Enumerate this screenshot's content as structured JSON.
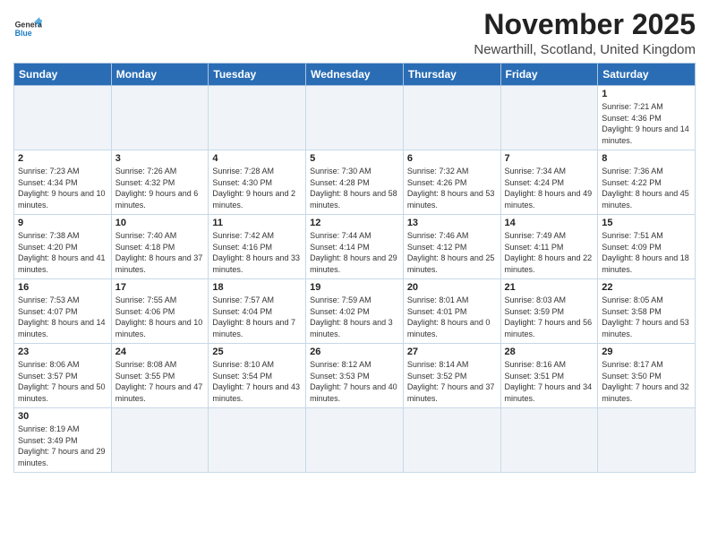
{
  "header": {
    "logo_general": "General",
    "logo_blue": "Blue",
    "title": "November 2025",
    "subtitle": "Newarthill, Scotland, United Kingdom"
  },
  "weekdays": [
    "Sunday",
    "Monday",
    "Tuesday",
    "Wednesday",
    "Thursday",
    "Friday",
    "Saturday"
  ],
  "weeks": [
    [
      {
        "day": "",
        "empty": true
      },
      {
        "day": "",
        "empty": true
      },
      {
        "day": "",
        "empty": true
      },
      {
        "day": "",
        "empty": true
      },
      {
        "day": "",
        "empty": true
      },
      {
        "day": "",
        "empty": true
      },
      {
        "day": "1",
        "sunrise": "7:21 AM",
        "sunset": "4:36 PM",
        "daylight": "9 hours and 14 minutes."
      }
    ],
    [
      {
        "day": "2",
        "sunrise": "7:23 AM",
        "sunset": "4:34 PM",
        "daylight": "9 hours and 10 minutes."
      },
      {
        "day": "3",
        "sunrise": "7:26 AM",
        "sunset": "4:32 PM",
        "daylight": "9 hours and 6 minutes."
      },
      {
        "day": "4",
        "sunrise": "7:28 AM",
        "sunset": "4:30 PM",
        "daylight": "9 hours and 2 minutes."
      },
      {
        "day": "5",
        "sunrise": "7:30 AM",
        "sunset": "4:28 PM",
        "daylight": "8 hours and 58 minutes."
      },
      {
        "day": "6",
        "sunrise": "7:32 AM",
        "sunset": "4:26 PM",
        "daylight": "8 hours and 53 minutes."
      },
      {
        "day": "7",
        "sunrise": "7:34 AM",
        "sunset": "4:24 PM",
        "daylight": "8 hours and 49 minutes."
      },
      {
        "day": "8",
        "sunrise": "7:36 AM",
        "sunset": "4:22 PM",
        "daylight": "8 hours and 45 minutes."
      }
    ],
    [
      {
        "day": "9",
        "sunrise": "7:38 AM",
        "sunset": "4:20 PM",
        "daylight": "8 hours and 41 minutes."
      },
      {
        "day": "10",
        "sunrise": "7:40 AM",
        "sunset": "4:18 PM",
        "daylight": "8 hours and 37 minutes."
      },
      {
        "day": "11",
        "sunrise": "7:42 AM",
        "sunset": "4:16 PM",
        "daylight": "8 hours and 33 minutes."
      },
      {
        "day": "12",
        "sunrise": "7:44 AM",
        "sunset": "4:14 PM",
        "daylight": "8 hours and 29 minutes."
      },
      {
        "day": "13",
        "sunrise": "7:46 AM",
        "sunset": "4:12 PM",
        "daylight": "8 hours and 25 minutes."
      },
      {
        "day": "14",
        "sunrise": "7:49 AM",
        "sunset": "4:11 PM",
        "daylight": "8 hours and 22 minutes."
      },
      {
        "day": "15",
        "sunrise": "7:51 AM",
        "sunset": "4:09 PM",
        "daylight": "8 hours and 18 minutes."
      }
    ],
    [
      {
        "day": "16",
        "sunrise": "7:53 AM",
        "sunset": "4:07 PM",
        "daylight": "8 hours and 14 minutes."
      },
      {
        "day": "17",
        "sunrise": "7:55 AM",
        "sunset": "4:06 PM",
        "daylight": "8 hours and 10 minutes."
      },
      {
        "day": "18",
        "sunrise": "7:57 AM",
        "sunset": "4:04 PM",
        "daylight": "8 hours and 7 minutes."
      },
      {
        "day": "19",
        "sunrise": "7:59 AM",
        "sunset": "4:02 PM",
        "daylight": "8 hours and 3 minutes."
      },
      {
        "day": "20",
        "sunrise": "8:01 AM",
        "sunset": "4:01 PM",
        "daylight": "8 hours and 0 minutes."
      },
      {
        "day": "21",
        "sunrise": "8:03 AM",
        "sunset": "3:59 PM",
        "daylight": "7 hours and 56 minutes."
      },
      {
        "day": "22",
        "sunrise": "8:05 AM",
        "sunset": "3:58 PM",
        "daylight": "7 hours and 53 minutes."
      }
    ],
    [
      {
        "day": "23",
        "sunrise": "8:06 AM",
        "sunset": "3:57 PM",
        "daylight": "7 hours and 50 minutes."
      },
      {
        "day": "24",
        "sunrise": "8:08 AM",
        "sunset": "3:55 PM",
        "daylight": "7 hours and 47 minutes."
      },
      {
        "day": "25",
        "sunrise": "8:10 AM",
        "sunset": "3:54 PM",
        "daylight": "7 hours and 43 minutes."
      },
      {
        "day": "26",
        "sunrise": "8:12 AM",
        "sunset": "3:53 PM",
        "daylight": "7 hours and 40 minutes."
      },
      {
        "day": "27",
        "sunrise": "8:14 AM",
        "sunset": "3:52 PM",
        "daylight": "7 hours and 37 minutes."
      },
      {
        "day": "28",
        "sunrise": "8:16 AM",
        "sunset": "3:51 PM",
        "daylight": "7 hours and 34 minutes."
      },
      {
        "day": "29",
        "sunrise": "8:17 AM",
        "sunset": "3:50 PM",
        "daylight": "7 hours and 32 minutes."
      }
    ],
    [
      {
        "day": "30",
        "sunrise": "8:19 AM",
        "sunset": "3:49 PM",
        "daylight": "7 hours and 29 minutes."
      },
      {
        "day": "",
        "empty": true
      },
      {
        "day": "",
        "empty": true
      },
      {
        "day": "",
        "empty": true
      },
      {
        "day": "",
        "empty": true
      },
      {
        "day": "",
        "empty": true
      },
      {
        "day": "",
        "empty": true
      }
    ]
  ],
  "labels": {
    "sunrise_prefix": "Sunrise: ",
    "sunset_prefix": "Sunset: ",
    "daylight_prefix": "Daylight: "
  }
}
